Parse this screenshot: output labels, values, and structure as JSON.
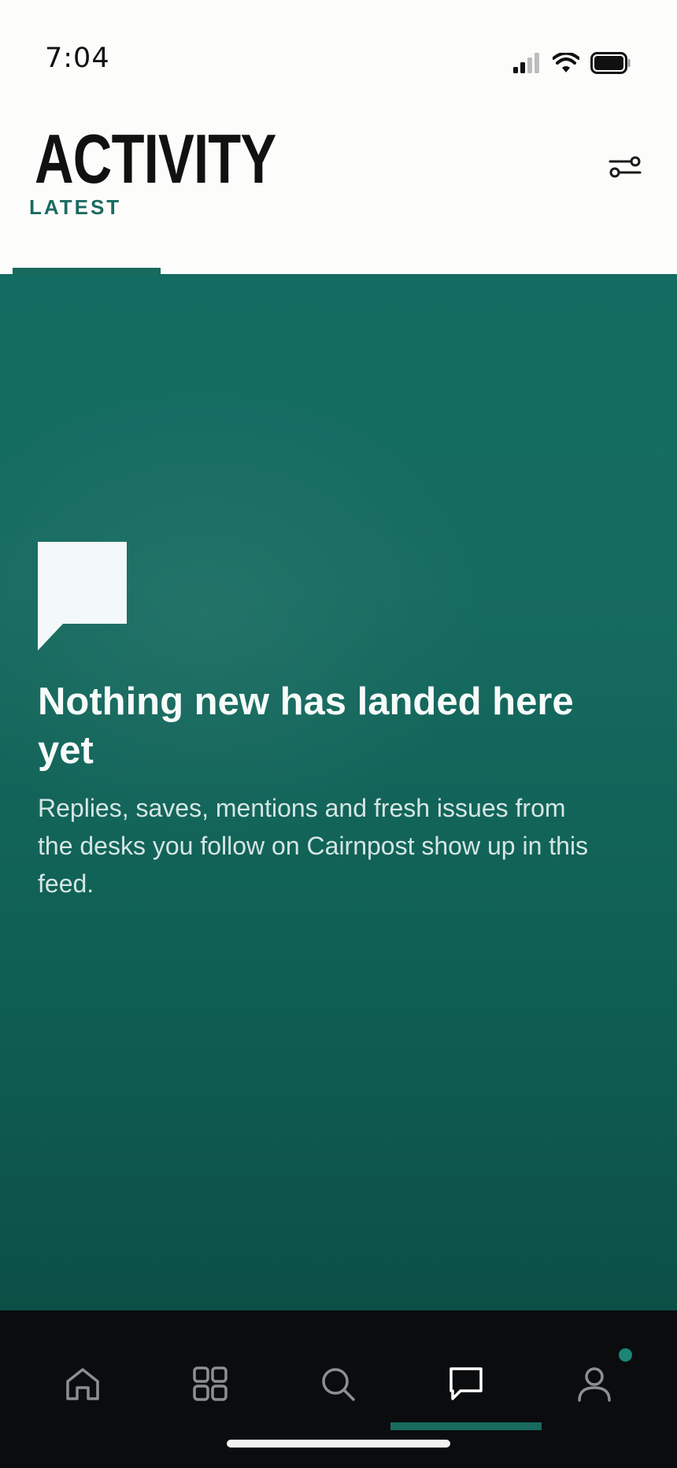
{
  "status_bar": {
    "time": "7:04",
    "icons": [
      "signal-icon",
      "wifi-icon",
      "battery-icon"
    ]
  },
  "header": {
    "title": "ACTIVITY",
    "filter_icon": "sliders-icon"
  },
  "tabs": [
    {
      "label": "LATEST",
      "active": true
    }
  ],
  "empty_state": {
    "icon": "speech-bubble-icon",
    "title": "Nothing new has landed here yet",
    "body": "Replies, saves, mentions and fresh issues from the desks you follow on Cairnpost show up in this feed."
  },
  "bottom_nav": {
    "items": [
      {
        "id": "home",
        "icon": "home-icon",
        "active": false
      },
      {
        "id": "sections",
        "icon": "grid-icon",
        "active": false
      },
      {
        "id": "search",
        "icon": "search-icon",
        "active": false
      },
      {
        "id": "activity",
        "icon": "chat-bubble-icon",
        "active": true
      },
      {
        "id": "profile",
        "icon": "user-icon",
        "active": false,
        "has_notification": true
      }
    ]
  },
  "colors": {
    "accent": "#176a5e",
    "feed_top": "#136c61",
    "feed_bottom": "#0c4f46",
    "nav_background": "#0b0c0e",
    "title_text": "#111111"
  }
}
